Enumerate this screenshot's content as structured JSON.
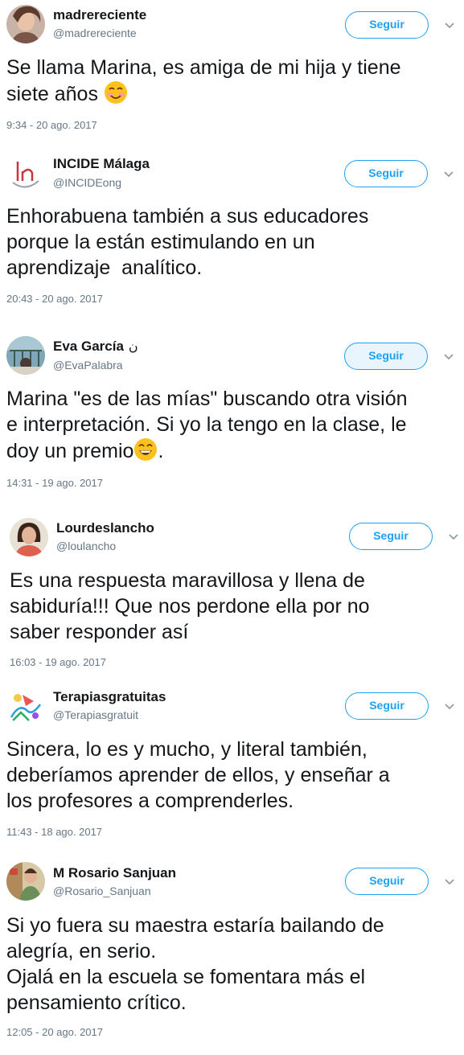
{
  "follow_label": "Seguir",
  "colors": {
    "accent": "#1da1f2",
    "text": "#14171a",
    "secondary": "#657786"
  },
  "tweets": [
    {
      "name": "madrereciente",
      "handle": "@madrereciente",
      "text": "Se llama Marina, es amiga de mi hija y tiene\nsiete años",
      "emoji": "smiling-face-emoji",
      "timestamp": "9:34 - 20 ago. 2017"
    },
    {
      "name": "INCIDE Málaga",
      "handle": "@INCIDEong",
      "text": "Enhorabuena también a sus educadores\nporque la están estimulando en un\naprendizaje  analítico.",
      "timestamp": "20:43 - 20 ago. 2017"
    },
    {
      "name": "Eva García",
      "name_mark": "ن",
      "handle": "@EvaPalabra",
      "text": "Marina \"es de las mías\" buscando otra visión\ne interpretación. Si yo la tengo en la clase, le\ndoy un premio",
      "text_after": ".",
      "emoji": "grinning-face-emoji",
      "timestamp": "14:31 - 19 ago. 2017"
    },
    {
      "name": "Lourdeslancho",
      "handle": "@loulancho",
      "text": "Es una respuesta maravillosa y llena de\nsabiduría!!! Que nos perdone ella por no\nsaber responder así",
      "timestamp": "16:03 - 19 ago. 2017"
    },
    {
      "name": "Terapiasgratuitas",
      "handle": "@Terapiasgratuit",
      "text": "Sincera, lo es y mucho, y literal también,\ndeberíamos aprender de ellos, y enseñar a\nlos profesores a comprenderles.",
      "timestamp": "11:43 - 18 ago. 2017"
    },
    {
      "name": "M Rosario Sanjuan",
      "handle": "@Rosario_Sanjuan",
      "text": "Si yo fuera su maestra estaría bailando de\nalegría, en serio.\nOjalá en la escuela se fomentara más el\npensamiento crítico.",
      "timestamp": "12:05 - 20 ago. 2017"
    }
  ]
}
